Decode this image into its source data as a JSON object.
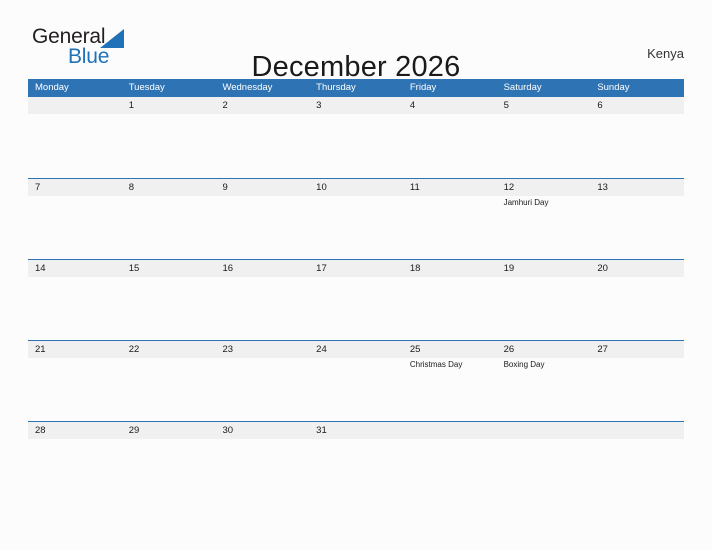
{
  "brand": {
    "name_part1": "General",
    "name_part2": "Blue",
    "triangle_color": "#1f72b8",
    "text_color": "#231f20"
  },
  "header": {
    "title": "December 2026",
    "region": "Kenya"
  },
  "calendar": {
    "header_bg": "#2e74b5",
    "band_bg": "#f0f0f0",
    "weekdays": [
      "Monday",
      "Tuesday",
      "Wednesday",
      "Thursday",
      "Friday",
      "Saturday",
      "Sunday"
    ],
    "weeks": [
      [
        {
          "day": ""
        },
        {
          "day": "1"
        },
        {
          "day": "2"
        },
        {
          "day": "3"
        },
        {
          "day": "4"
        },
        {
          "day": "5"
        },
        {
          "day": "6"
        }
      ],
      [
        {
          "day": "7"
        },
        {
          "day": "8"
        },
        {
          "day": "9"
        },
        {
          "day": "10"
        },
        {
          "day": "11"
        },
        {
          "day": "12",
          "event": "Jamhuri Day"
        },
        {
          "day": "13"
        }
      ],
      [
        {
          "day": "14"
        },
        {
          "day": "15"
        },
        {
          "day": "16"
        },
        {
          "day": "17"
        },
        {
          "day": "18"
        },
        {
          "day": "19"
        },
        {
          "day": "20"
        }
      ],
      [
        {
          "day": "21"
        },
        {
          "day": "22"
        },
        {
          "day": "23"
        },
        {
          "day": "24"
        },
        {
          "day": "25",
          "event": "Christmas Day"
        },
        {
          "day": "26",
          "event": "Boxing Day"
        },
        {
          "day": "27"
        }
      ],
      [
        {
          "day": "28"
        },
        {
          "day": "29"
        },
        {
          "day": "30"
        },
        {
          "day": "31"
        },
        {
          "day": ""
        },
        {
          "day": ""
        },
        {
          "day": ""
        }
      ]
    ]
  }
}
